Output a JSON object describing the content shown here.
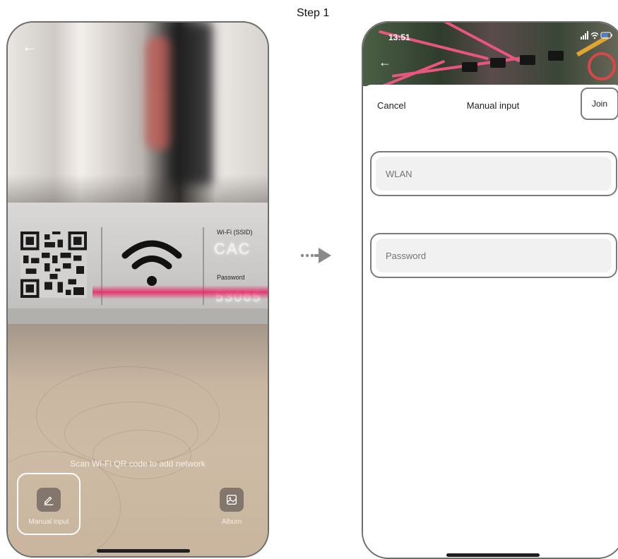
{
  "step": {
    "title": "Step 1"
  },
  "scanner": {
    "sign": {
      "ssid_label": "Wi-Fi (SSID)",
      "ssid_value": "CAC",
      "password_label": "Password",
      "password_value": "53065"
    },
    "hint": "Scan Wi-Fi QR code to add network",
    "manual_input_label": "Manual input",
    "album_label": "Album"
  },
  "manual_screen": {
    "status_time": "13:51",
    "cancel_label": "Cancel",
    "title": "Manual input",
    "join_label": "Join",
    "wlan_placeholder": "WLAN",
    "password_placeholder": "Password"
  },
  "colors": {
    "scan_line": "#e91e63",
    "wire": "#e8557f",
    "outline": "#7b7b7b"
  }
}
